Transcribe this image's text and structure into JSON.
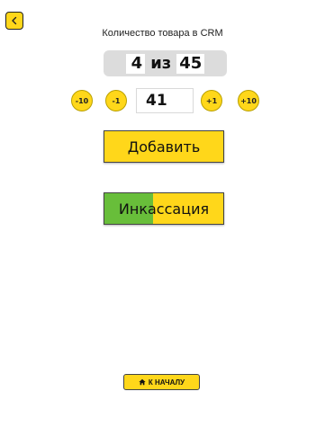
{
  "header": {
    "back_icon": "chevron-left-icon",
    "title": "Количество товара в CRM"
  },
  "counter": {
    "current": "4",
    "separator": "из",
    "total": "45"
  },
  "stepper": {
    "minus10": "-10",
    "minus1": "-1",
    "quantity": "41",
    "plus1": "+1",
    "plus10": "+10"
  },
  "actions": {
    "add_label": "Добавить",
    "cash_label": "Инкассация"
  },
  "footer": {
    "home_icon": "home-icon",
    "home_label": "К НАЧАЛУ"
  },
  "colors": {
    "accent": "#ffd71a",
    "green": "#68be3a",
    "counter_bg": "#dcdcdc"
  }
}
